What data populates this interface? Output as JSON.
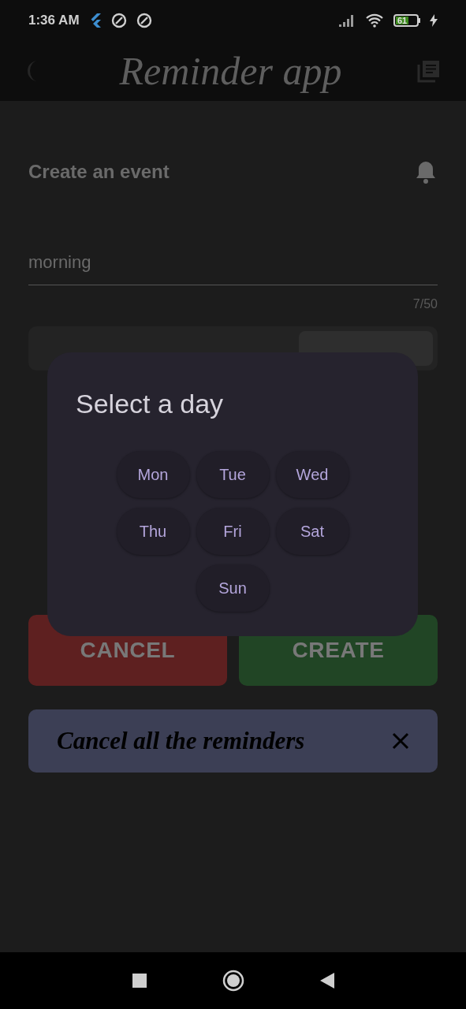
{
  "status_bar": {
    "time": "1:36 AM",
    "battery": "61"
  },
  "app_bar": {
    "title": "Reminder app"
  },
  "form": {
    "heading": "Create an event",
    "name_field": {
      "value": "morning",
      "counter": "7/50"
    }
  },
  "buttons": [
    {
      "label": "CANCEL",
      "kind": "cancel"
    },
    {
      "label": "CREATE",
      "kind": "create"
    }
  ],
  "cancel_all": {
    "label": "Cancel all the reminders"
  },
  "dialog": {
    "title": "Select a day",
    "days": [
      "Mon",
      "Tue",
      "Wed",
      "Thu",
      "Fri",
      "Sat",
      "Sun"
    ]
  }
}
